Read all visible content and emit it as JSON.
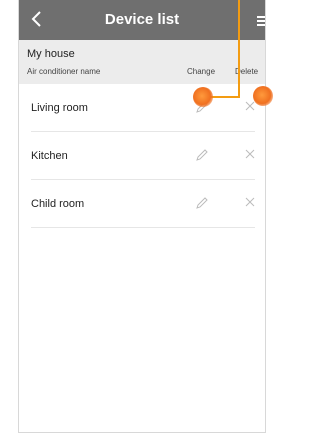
{
  "header": {
    "title": "Device list",
    "back_icon": "chevron-left-icon",
    "menu_icon": "menu-icon"
  },
  "subheader": {
    "house": "My house",
    "col_name": "Air conditioner name",
    "col_change": "Change",
    "col_delete": "Delete"
  },
  "devices": [
    {
      "name": "Living room"
    },
    {
      "name": "Kitchen"
    },
    {
      "name": "Child room"
    }
  ],
  "colors": {
    "header_bg": "#6f6f6f",
    "subheader_bg": "#ececec",
    "callout": "#f39c12",
    "marker": "#f07020"
  }
}
